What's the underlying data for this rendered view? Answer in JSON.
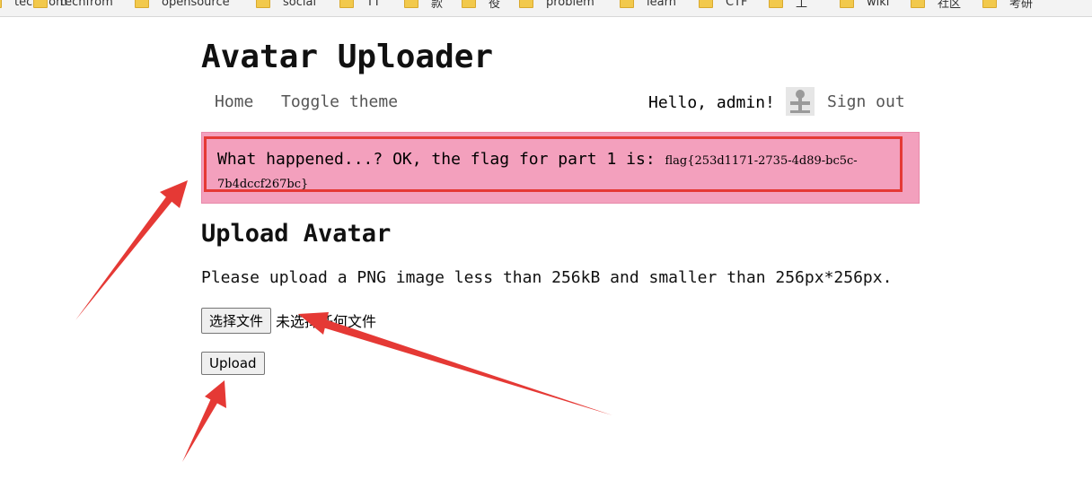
{
  "bookmarks": [
    {
      "label": "techfrom",
      "icon": "folder-icon"
    },
    {
      "label": "opensource",
      "icon": "folder-icon"
    },
    {
      "label": "social",
      "icon": "folder-icon"
    },
    {
      "label": "TT",
      "icon": "folder-icon"
    },
    {
      "label": "款",
      "icon": "folder-icon"
    },
    {
      "label": "役",
      "icon": "folder-icon"
    },
    {
      "label": "problem",
      "icon": "folder-icon"
    },
    {
      "label": "learn",
      "icon": "folder-icon"
    },
    {
      "label": "CTF",
      "icon": "folder-icon"
    },
    {
      "label": "工",
      "icon": "folder-icon"
    },
    {
      "label": "wiki",
      "icon": "folder-icon"
    },
    {
      "label": "社区",
      "icon": "folder-icon"
    },
    {
      "label": "考研",
      "icon": "folder-icon"
    }
  ],
  "header": {
    "title": "Avatar Uploader"
  },
  "nav": {
    "home": "Home",
    "toggle_theme": "Toggle theme",
    "greeting": "Hello, admin!",
    "avatar_icon": "user-avatar-icon",
    "sign_out": "Sign out"
  },
  "flash": {
    "message": "What happened...? OK, the flag for part 1 is:",
    "flag": "flag{253d1171-2735-4d89-bc5c-7b4dccf267bc}"
  },
  "upload": {
    "title": "Upload Avatar",
    "instructions": "Please upload a PNG image less than 256kB and smaller than 256px*256px.",
    "choose_file_label": "选择文件",
    "file_status": "未选择任何文件",
    "upload_label": "Upload"
  },
  "colors": {
    "flash_background": "#f3a0bd",
    "annotation_red": "#e53935"
  }
}
